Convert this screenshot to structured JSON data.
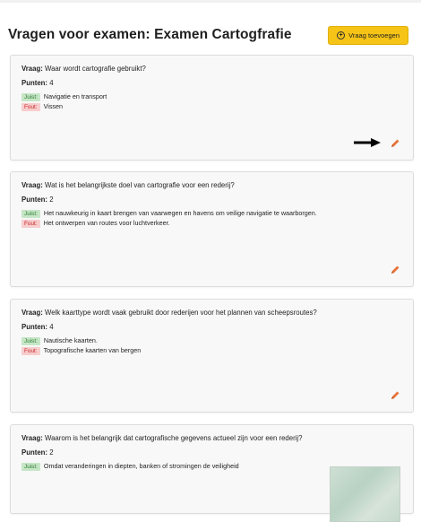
{
  "header": {
    "title": "Vragen voor examen: Examen Cartogfrafie",
    "add_button_label": "Vraag toevoegen"
  },
  "labels": {
    "question_prefix": "Vraag:",
    "points_prefix": "Punten:",
    "correct": "Juist:",
    "wrong": "Fout:"
  },
  "questions": [
    {
      "question": "Waar wordt cartografie gebruikt?",
      "points": "4",
      "correct": "Navigatie en transport",
      "wrong": "Vissen"
    },
    {
      "question": "Wat is het belangrijkste doel van cartografie voor een rederij?",
      "points": "2",
      "correct": "Het nauwkeurig in kaart brengen van vaarwegen en havens om veilige navigatie te waarborgen.",
      "wrong": "Het ontwerpen van routes voor luchtverkeer."
    },
    {
      "question": "Welk kaarttype wordt vaak gebruikt door rederijen voor het plannen van scheepsroutes?",
      "points": "4",
      "correct": "Nautische kaarten.",
      "wrong": "Topografische kaarten van bergen"
    },
    {
      "question": "Waarom is het belangrijk dat cartografische gegevens actueel zijn voor een rederij?",
      "points": "2",
      "correct": "Omdat veranderingen in diepten, banken of stromingen de veiligheid",
      "wrong": ""
    }
  ],
  "colors": {
    "accent_button": "#f6c417",
    "edit_icon": "#e8743b",
    "correct_tag": "#c6e6c7",
    "wrong_tag": "#f7cdcd"
  },
  "icons": {
    "add": "plus-circle-icon",
    "edit": "pencil-icon",
    "annotation": "arrow-right-icon"
  }
}
